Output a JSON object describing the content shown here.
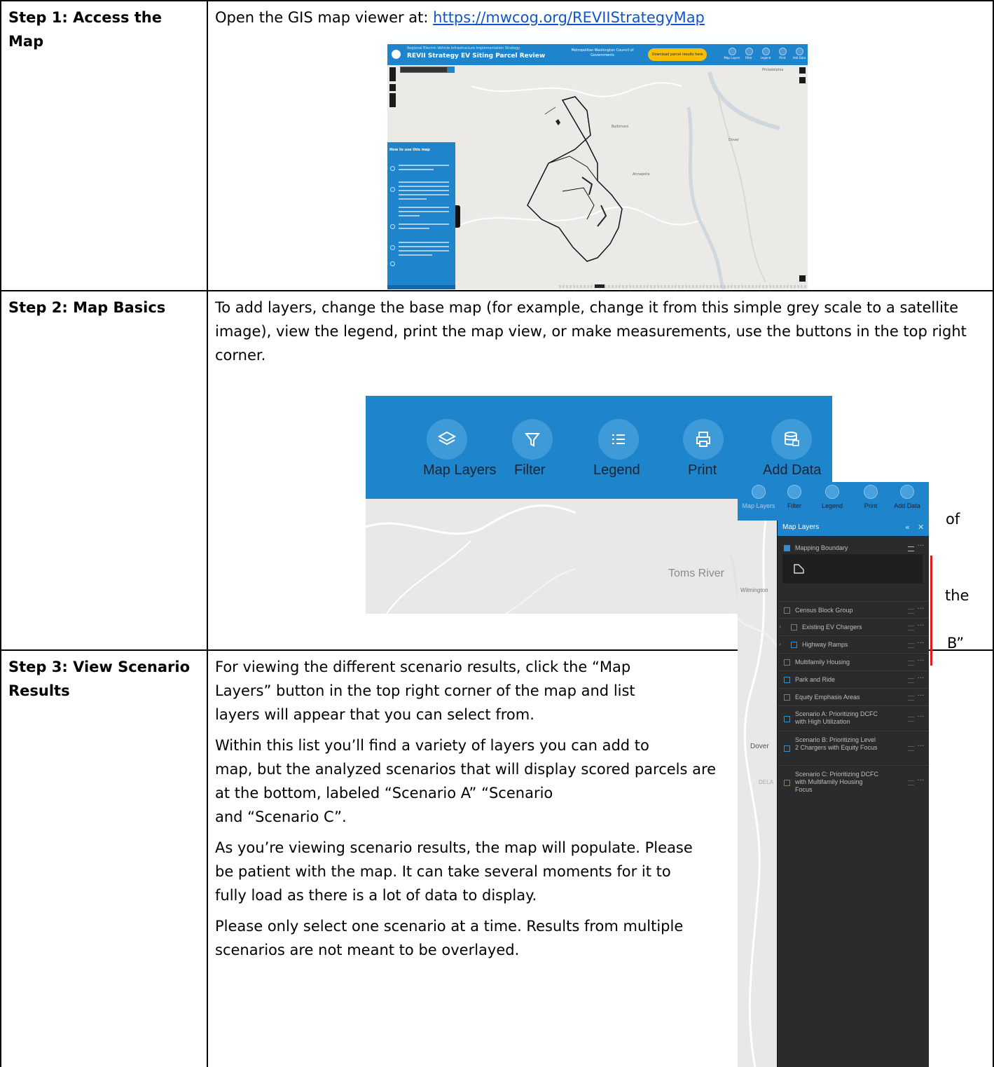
{
  "step1": {
    "label": "Step 1: Access the Map",
    "intro": "Open the GIS map viewer at: ",
    "link": "https://mwcog.org/REVIIStrategyMap",
    "screenshot": {
      "subtitle": "Regional Electric Vehicle Infrastructure Implementation Strategy",
      "title": "REVII Strategy EV Siting Parcel Review",
      "org": "Metropolitan Washington Council of Governments",
      "download": "Download parcel results here",
      "buttons": [
        "Map Layers",
        "Filter",
        "Legend",
        "Print",
        "Add Data"
      ],
      "panel_title": "How to use this map",
      "cities": [
        "Philadelphia",
        "Baltimore",
        "Annapolis",
        "Dover"
      ]
    }
  },
  "step2": {
    "label": "Step 2: Map Basics",
    "text": "To add layers, change the base map (for example, change it from this simple grey scale to a satellite image), view the legend, print the map view, or make measurements, use the buttons in the top right corner.",
    "toolbar": {
      "buttons": [
        {
          "label": "Map Layers",
          "icon": "layers-icon"
        },
        {
          "label": "Filter",
          "icon": "filter-icon"
        },
        {
          "label": "Legend",
          "icon": "legend-icon"
        },
        {
          "label": "Print",
          "icon": "print-icon"
        },
        {
          "label": "Add Data",
          "icon": "database-icon"
        }
      ],
      "city": "Toms River"
    }
  },
  "step3": {
    "label": "Step 3: View Scenario Results",
    "para1": "For viewing the different scenario results, click the “Map Layers” button in the top right corner of the map and list",
    "para1_tail": "of",
    "para1_end": "layers will appear that you can select from.",
    "para2": "Within this list you’ll find a variety of layers you can add to",
    "para2_tail": "the",
    "para2_mid": "map, but the analyzed scenarios that will display scored parcels are at the bottom, labeled “Scenario A” “Scenario",
    "para2_tail2": "B”",
    "para2_end": "and “Scenario C”.",
    "para3": "As you’re viewing scenario results, the map will populate. Please be patient with the map. It can take several moments for it to fully load as there is a lot of data to display.",
    "para4": "Please only select one scenario at a time. Results from multiple scenarios are not meant to be overlayed.",
    "panel": {
      "buttons": [
        "Map Layers",
        "Filter",
        "Legend",
        "Print",
        "Add Data"
      ],
      "title": "Map Layers",
      "layers": [
        {
          "name": "Mapping Boundary",
          "checked": true
        },
        {
          "name": "Census Block Group",
          "checked": false
        },
        {
          "name": "Existing EV Chargers",
          "checked": false
        },
        {
          "name": "Highway Ramps",
          "checked": false
        },
        {
          "name": "Multifamily Housing",
          "checked": false
        },
        {
          "name": "Park and Ride",
          "checked": false
        },
        {
          "name": "Equity Emphasis Areas",
          "checked": false
        },
        {
          "name": "Scenario A: Prioritizing DCFC with High Utilization",
          "checked": false
        },
        {
          "name": "Scenario B: Prioritizing Level 2 Chargers with Equity Focus",
          "checked": false
        },
        {
          "name": "Scenario C: Prioritizing DCFC with Multifamily Housing Focus",
          "checked": false
        }
      ],
      "cities": [
        "Wilmington",
        "Dover",
        "DELA"
      ]
    }
  }
}
